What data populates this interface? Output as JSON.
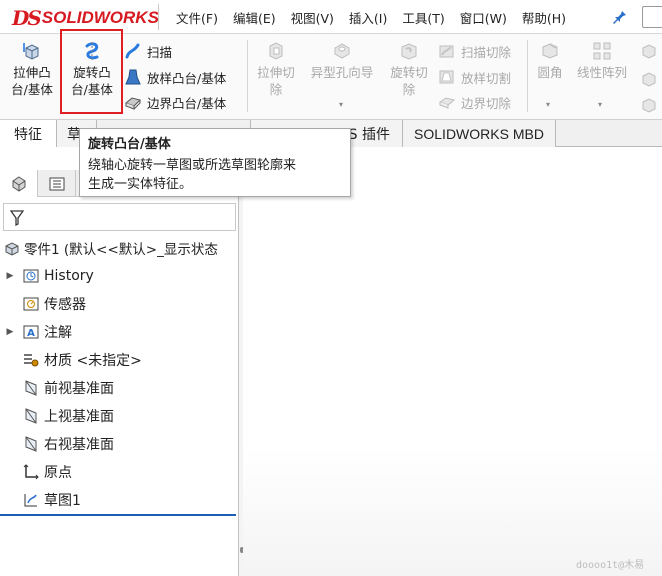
{
  "app": {
    "logo_ds": "DS",
    "logo_text": "SOLIDWORKS"
  },
  "menu": [
    "文件(F)",
    "编辑(E)",
    "视图(V)",
    "插入(I)",
    "工具(T)",
    "窗口(W)",
    "帮助(H)"
  ],
  "ribbon": {
    "extrude_boss": [
      "拉伸凸",
      "台/基体"
    ],
    "revolve_boss": [
      "旋转凸",
      "台/基体"
    ],
    "sweep": "扫描",
    "loft": "放样凸台/基体",
    "boundary": "边界凸台/基体",
    "extrude_cut": [
      "拉伸切",
      "除"
    ],
    "hole_wizard": "异型孔向导",
    "revolve_cut": [
      "旋转切",
      "除"
    ],
    "sweep_cut": "扫描切除",
    "loft_cut": "放样切割",
    "boundary_cut": "边界切除",
    "fillet": "圆角",
    "linear_pattern": "线性阵列"
  },
  "tabs": {
    "features": "特征",
    "sketch": "草",
    "plugins": "S 插件",
    "mbd": "SOLIDWORKS MBD"
  },
  "tooltip": {
    "title": "旋转凸台/基体",
    "line1": "绕轴心旋转一草图或所选草图轮廓来",
    "line2": "生成一实体特征。"
  },
  "tree": {
    "part": "零件1 (默认<<默认>_显示状态",
    "history": "History",
    "sensors": "传感器",
    "annotations": "注解",
    "material": "材质 <未指定>",
    "front_plane": "前视基准面",
    "top_plane": "上视基准面",
    "right_plane": "右视基准面",
    "origin": "原点",
    "sketch1": "草图1"
  },
  "watermark": "doooo1t@木易",
  "colors": {
    "brand": "#d71920",
    "selection": "#e02020",
    "sketch_underline": "#1a5fb4",
    "disabled": "#a9a9a9"
  }
}
